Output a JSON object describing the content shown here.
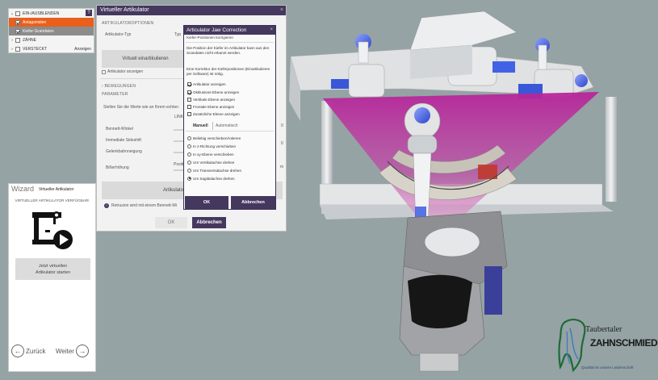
{
  "left_panel": {
    "rows": [
      {
        "chevron": "v",
        "label": "EIN-/AUSBLENDEN",
        "checked": false
      },
      {
        "chevron": "",
        "label": "Antagonisten",
        "checked": true
      },
      {
        "chevron": "",
        "label": "Kiefer-Scandaten",
        "checked": true
      },
      {
        "chevron": ">",
        "label": "ZÄHNE",
        "checked": false
      },
      {
        "chevron": ">",
        "label": "VERSTECKT",
        "checked": false
      }
    ],
    "help_label": "?",
    "hidden_value": "Anzeigen"
  },
  "va_dialog": {
    "title": "Virtueller Artikulator",
    "close": "×",
    "section_options": "ARTIKULATOROPTIONEN",
    "type_label": "Artikulator-Typ",
    "type_value": "Typ",
    "create_button": "Virtuell einartikulieren",
    "show_articulator": "Artikulator anzeigen",
    "section_movements": "BEWEGUNGEN",
    "section_parameters": "PARAMETER",
    "param_hint": "Stellen Sie die Werte wie an Ihrem echten",
    "column_left": "LINKS",
    "params": [
      "Bennett-Winkel",
      "Immediate Sideshift",
      "Gelenkbahnneigung",
      "Bißerhöhung"
    ],
    "position_label": "Positi",
    "articulator_button": "Artikulator",
    "info_text": "Retrusion wird mit einem Bennett-Wi",
    "ok": "OK",
    "cancel": "Abbrechen"
  },
  "jaw_correction": {
    "title": "Articulator Jaw Correction",
    "close": "×",
    "subtitle": "Kiefer-Positionen korrigieren",
    "desc1": "Die Position der Kiefer im Artikulator kann aus den Scandaten nicht erkannt werden.",
    "desc2": "Eine Korrektur der Kieferpositionen (Einartikulieren per Software) ist nötig.",
    "checkboxes": [
      {
        "label": "Artikulator anzeigen",
        "checked": true
      },
      {
        "label": "Okklusions-Ebene anzeigen",
        "checked": true
      },
      {
        "label": "Vertikale Ebene anzeigen",
        "checked": false
      },
      {
        "label": "Frontale Ebene anzeigen",
        "checked": false
      },
      {
        "label": "Zusätzliche Ebene anzeigen",
        "checked": false
      }
    ],
    "tabs": [
      "Manuell",
      "Automatisch"
    ],
    "radios": [
      {
        "label": "Beliebig verschieben/rotieren",
        "selected": false
      },
      {
        "label": "In z-Richtung verschieben",
        "selected": false
      },
      {
        "label": "In xy-Ebene verschieben",
        "selected": false
      },
      {
        "label": "Um Vertikalachse drehen",
        "selected": false
      },
      {
        "label": "Um Transversalachse drehen",
        "selected": false
      },
      {
        "label": "Um Sagittalachse drehen",
        "selected": true
      }
    ],
    "ok": "OK",
    "cancel": "Abbrechen"
  },
  "wizard": {
    "title": "Wizard",
    "subtitle": "Virtueller Artikulator",
    "status": "VIRTUELLER ARTIKULATOR VERFÜGBAR!",
    "start_line1": "Jetzt virtuellen",
    "start_line2": "Artikulator starten",
    "back": "Zurück",
    "next": "Weiter",
    "icon": "articulator-play-icon"
  },
  "logo": {
    "line1": "Taubertaler",
    "line2": "ZAHNSCHMIEDE",
    "tagline": "Qualität ist unsere Leidenschaft"
  },
  "colors": {
    "accent_purple": "#45385e",
    "accent_orange": "#e8601c",
    "viewport_bg": "#95a3a4",
    "plane_magenta": "#c0289e"
  }
}
